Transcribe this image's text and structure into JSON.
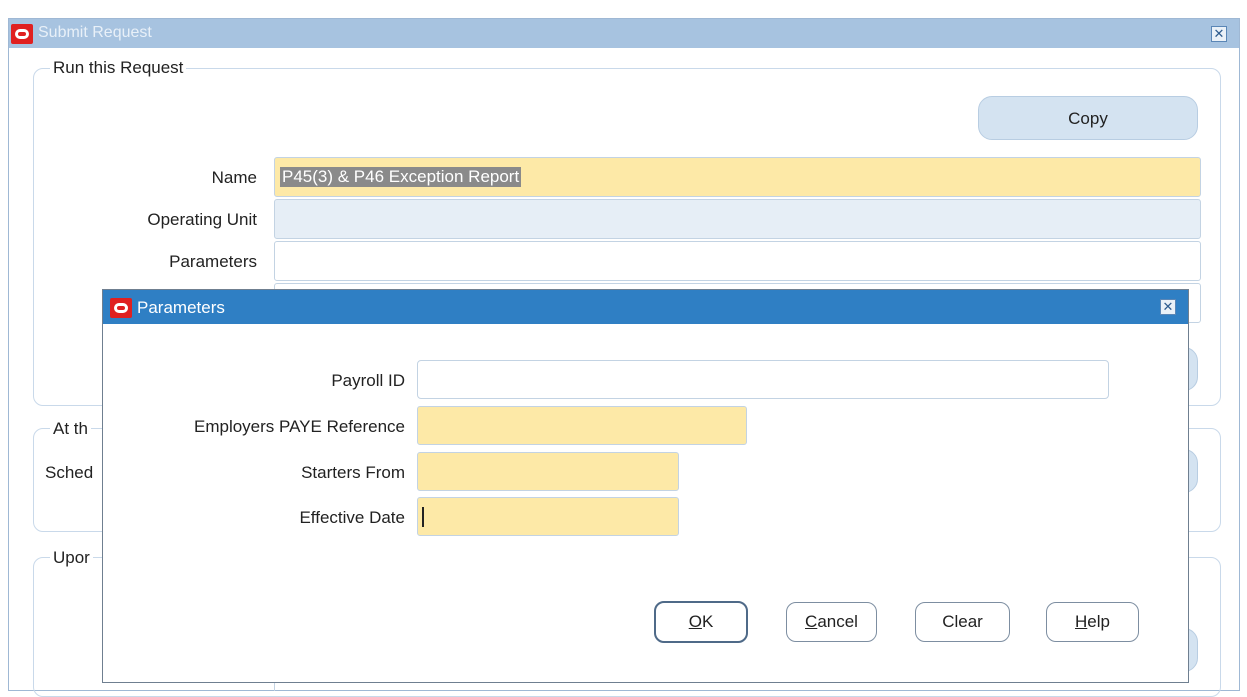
{
  "bg_window": {
    "title": "Submit Request",
    "run_group_legend": "Run this Request",
    "copy_label": "Copy",
    "fields": [
      {
        "label": "Name",
        "value": "P45(3) & P46 Exception Report"
      },
      {
        "label": "Operating Unit",
        "value": ""
      },
      {
        "label": "Parameters",
        "value": ""
      }
    ],
    "at_group_partial": "At th",
    "schedule_partial": "Sched",
    "upon_group_partial": "Upor"
  },
  "dialog": {
    "title": "Parameters",
    "fields": [
      {
        "label": "Payroll ID",
        "value": ""
      },
      {
        "label": "Employers PAYE Reference",
        "value": ""
      },
      {
        "label": "Starters From",
        "value": ""
      },
      {
        "label": "Effective Date",
        "value": ""
      }
    ],
    "buttons": {
      "ok": {
        "mnemonic": "O",
        "rest": "K"
      },
      "cancel": {
        "mnemonic": "C",
        "rest": "ancel"
      },
      "clear": "Clear",
      "help": {
        "mnemonic": "H",
        "rest": "elp"
      }
    }
  },
  "colors": {
    "required_field": "#fde9a7",
    "readonly_field": "#e6eef6",
    "dialog_titlebar": "#2f7fc4",
    "bg_titlebar": "#a7c3e0",
    "brand_icon": "#e02020"
  }
}
